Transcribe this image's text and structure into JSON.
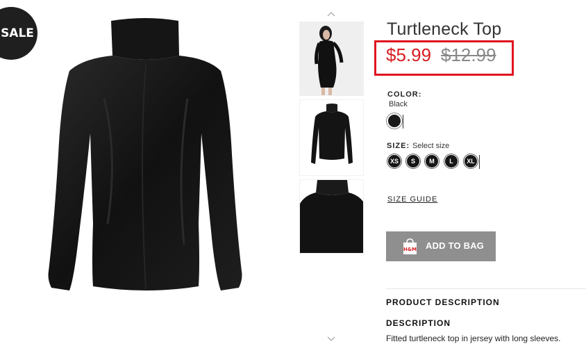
{
  "badge": {
    "label": "SALE"
  },
  "product": {
    "title": "Turtleneck Top",
    "sale_price": "$5.99",
    "original_price": "$12.99",
    "highlight_color": "#e0141f"
  },
  "color": {
    "label": "COLOR:",
    "selected": "Black",
    "swatch_hex": "#1a1a1a"
  },
  "size": {
    "label": "SIZE:",
    "placeholder": "Select size",
    "options": [
      "XS",
      "S",
      "M",
      "L",
      "XL"
    ]
  },
  "size_guide": {
    "label": "SIZE GUIDE"
  },
  "cart": {
    "add_label": "ADD TO BAG",
    "bag_icon": "shopping-bag-icon",
    "brand": "H&M"
  },
  "description": {
    "section_heading": "PRODUCT DESCRIPTION",
    "heading": "DESCRIPTION",
    "text": "Fitted turtleneck top in jersey with long sleeves."
  },
  "thumbnails": {
    "up_icon": "chevron-up-icon",
    "down_icon": "chevron-down-icon",
    "items": [
      "model-view",
      "front-view",
      "detail-view"
    ]
  }
}
